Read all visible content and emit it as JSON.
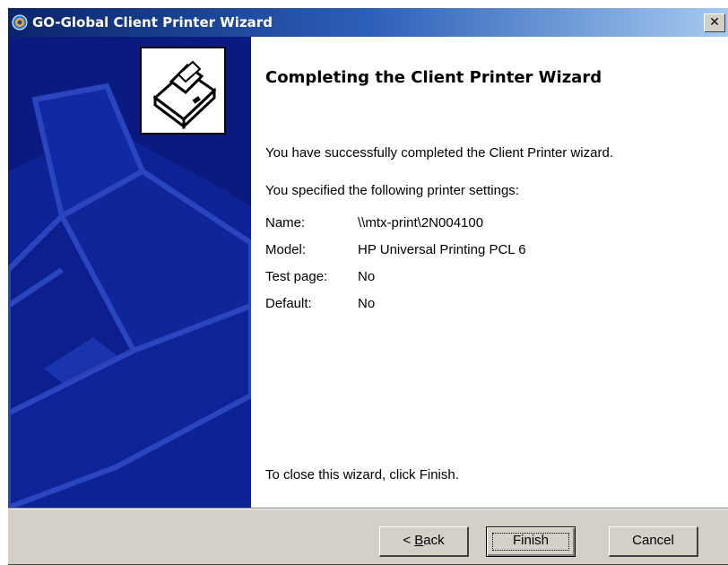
{
  "window": {
    "title": "GO-Global Client Printer Wizard",
    "close_glyph": "✕"
  },
  "icons": {
    "app": "go-global-app-icon",
    "logo": "printer-icon",
    "close": "close-icon"
  },
  "content": {
    "heading": "Completing the Client Printer Wizard",
    "success_text": "You have successfully completed the Client Printer wizard.",
    "settings_intro": "You specified the following printer settings:",
    "settings": [
      {
        "label": "Name:",
        "value": "\\\\mtx-print\\2N004100"
      },
      {
        "label": "Model:",
        "value": "HP Universal Printing PCL 6"
      },
      {
        "label": "Test page:",
        "value": "No"
      },
      {
        "label": "Default:",
        "value": "No"
      }
    ],
    "close_instruction": "To close this wizard, click Finish."
  },
  "buttons": {
    "back": "< Back",
    "back_rest": "ack",
    "back_prefix": "< ",
    "back_accel": "B",
    "finish": "Finish",
    "cancel": "Cancel"
  },
  "colors": {
    "title_start": "#0a246a",
    "title_end": "#a6caf0",
    "banner": "#0a1a80",
    "dialog_face": "#d4d0c8"
  }
}
